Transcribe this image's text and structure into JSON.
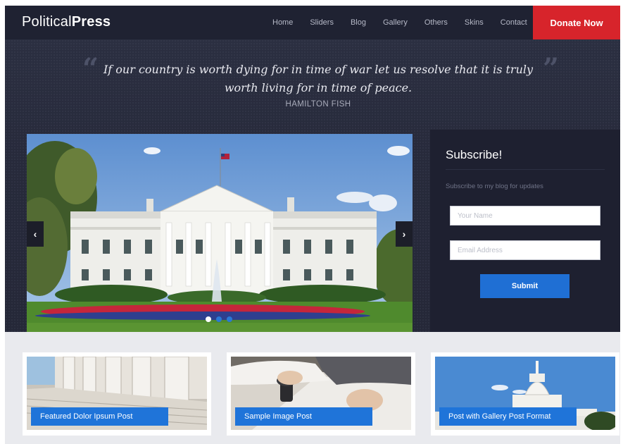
{
  "header": {
    "logo_light": "Political",
    "logo_bold": "Press",
    "nav": [
      "Home",
      "Sliders",
      "Blog",
      "Gallery",
      "Others",
      "Skins",
      "Contact"
    ],
    "donate_label": "Donate Now"
  },
  "hero": {
    "quote": "If our country is worth dying for in time of war let us resolve that it is truly worth living for in time of peace.",
    "author": "HAMILTON FISH",
    "open_mark": "“",
    "close_mark": "”"
  },
  "slider": {
    "prev_icon": "chevron-left-icon",
    "next_icon": "chevron-right-icon",
    "prev_glyph": "‹",
    "next_glyph": "›",
    "slide_count": 3,
    "active_slide": 1
  },
  "subscribe": {
    "title": "Subscribe!",
    "text": "Subscribe to my blog for updates",
    "name_placeholder": "Your Name",
    "email_placeholder": "Email Address",
    "submit_label": "Submit"
  },
  "posts": [
    {
      "title": "Featured Dolor Ipsum Post"
    },
    {
      "title": "Sample Image Post"
    },
    {
      "title": "Post with Gallery Post Format"
    }
  ],
  "colors": {
    "header_bg": "#1f2232",
    "donate_red": "#d7242b",
    "accent_blue": "#1f74d9",
    "hero_bg": "#272a3b",
    "subscribe_bg": "#1e2030",
    "posts_bg": "#e9eaee"
  }
}
